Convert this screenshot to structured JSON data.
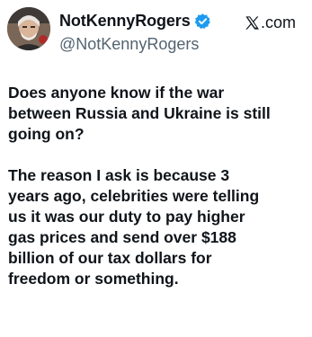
{
  "author": {
    "display_name": "NotKennyRogers",
    "handle": "@NotKennyRogers",
    "verified": true,
    "avatar_icon": "profile-photo"
  },
  "platform": {
    "label": ".com",
    "logo_icon": "x-logo-icon"
  },
  "tweet": {
    "paragraph_1": "Does anyone know if the war\nbetween Russia and Ukraine is still\ngoing on?",
    "paragraph_2": "The reason I ask is because 3\nyears ago, celebrities were telling\nus it was our duty to pay higher\ngas prices and send over $188\nbillion of our tax dollars for\nfreedom or something."
  },
  "colors": {
    "text": "#0f1419",
    "secondary_text": "#536471",
    "verified_blue": "#1d9bf0",
    "background": "#ffffff"
  }
}
